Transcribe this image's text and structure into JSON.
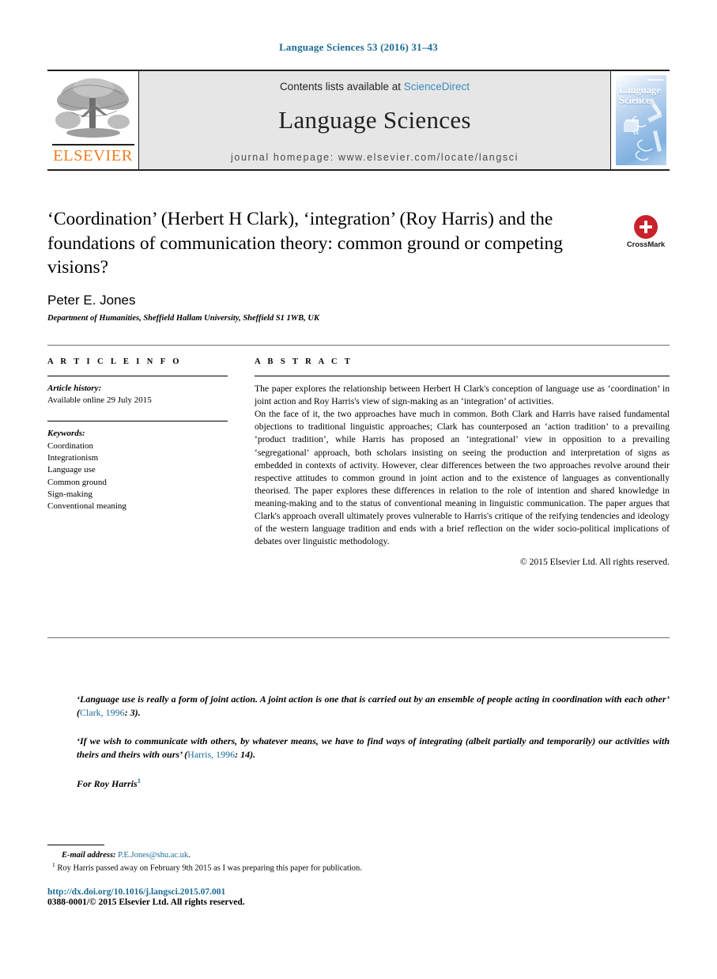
{
  "running_head": "Language Sciences 53 (2016) 31–43",
  "masthead": {
    "contents_prefix": "Contents lists available at ",
    "sciencedirect": "ScienceDirect",
    "journal_title": "Language Sciences",
    "homepage": "journal homepage: www.elsevier.com/locate/langsci",
    "publisher_name": "ELSEVIER",
    "cover_title_line1": "Language",
    "cover_title_line2": "Sciences",
    "cover_alpha": "α"
  },
  "article": {
    "title": "‘Coordination’ (Herbert H Clark), ‘integration’ (Roy Harris) and the foundations of communication theory: common ground or competing visions?",
    "author": "Peter E. Jones",
    "affiliation": "Department of Humanities, Sheffield Hallam University, Sheffield S1 1WB, UK",
    "crossmark_label": "CrossMark"
  },
  "info": {
    "heading": "A R T I C L E  I N F O",
    "history_label": "Article history:",
    "history_value": "Available online 29 July 2015",
    "keywords_label": "Keywords:",
    "keywords": [
      "Coordination",
      "Integrationism",
      "Language use",
      "Common ground",
      "Sign-making",
      "Conventional meaning"
    ]
  },
  "abstract": {
    "heading": "A B S T R A C T",
    "paragraphs": [
      "The paper explores the relationship between Herbert H Clark's conception of language use as ‘coordination’ in joint action and Roy Harris's view of sign-making as an ‘integration’ of activities.",
      "On the face of it, the two approaches have much in common. Both Clark and Harris have raised fundamental objections to traditional linguistic approaches; Clark has counterposed an ‘action tradition’ to a prevailing ‘product tradition’, while Harris has proposed an ‘integrational’ view in opposition to a prevailing ‘segregational’ approach, both scholars insisting on seeing the production and interpretation of signs as embedded in contexts of activity. However, clear differences between the two approaches revolve around their respective attitudes to common ground in joint action and to the existence of languages as conventionally theorised. The paper explores these differences in relation to the role of intention and shared knowledge in meaning-making and to the status of conventional meaning in linguistic communication. The paper argues that Clark's approach overall ultimately proves vulnerable to Harris's critique of the reifying tendencies and ideology of the western language tradition and ends with a brief reflection on the wider socio-political implications of debates over linguistic methodology."
    ],
    "copyright": "© 2015 Elsevier Ltd. All rights reserved."
  },
  "epigraph": {
    "quote1_part1": "‘Language use is really a form of joint action. A joint action is one that is carried out by an ensemble of people acting in coordination with each other’ (",
    "quote1_citation": "Clark, 1996",
    "quote1_part2": ": 3).",
    "quote2_part1": "‘If we wish to communicate with others, by whatever means, we have to find ways of integrating (albeit partially and temporarily) our activities with theirs and theirs with ours’ (",
    "quote2_citation": "Harris, 1996",
    "quote2_part2": ": 14).",
    "dedication": "For Roy Harris",
    "dedication_marker": "1"
  },
  "footnotes": {
    "email_label": "E-mail address:",
    "email_value": "P.E.Jones@shu.ac.uk",
    "email_suffix": ".",
    "note1_marker": "1",
    "note1_text": "Roy Harris passed away on February 9th 2015 as I was preparing this paper for publication."
  },
  "footer": {
    "doi": "http://dx.doi.org/10.1016/j.langsci.2015.07.001",
    "issn": "0388-0001/© 2015 Elsevier Ltd. All rights reserved."
  }
}
